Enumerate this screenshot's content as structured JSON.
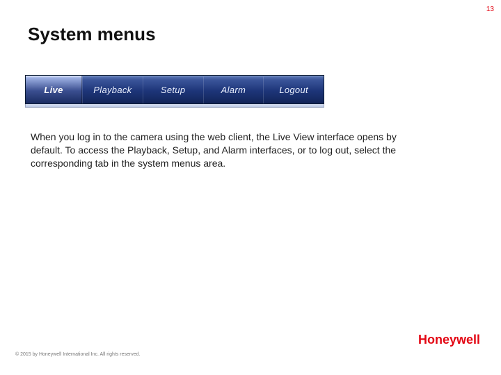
{
  "page_number": "13",
  "title": "System menus",
  "tabs": {
    "live": "Live",
    "playback": "Playback",
    "setup": "Setup",
    "alarm": "Alarm",
    "logout": "Logout"
  },
  "body_text": "When you log in to the camera using the web client, the Live View interface opens by default. To access the Playback, Setup, and Alarm interfaces, or to log out, select the corresponding tab in the system menus area.",
  "brand": "Honeywell",
  "copyright": "© 2015 by Honeywell International Inc. All rights reserved."
}
